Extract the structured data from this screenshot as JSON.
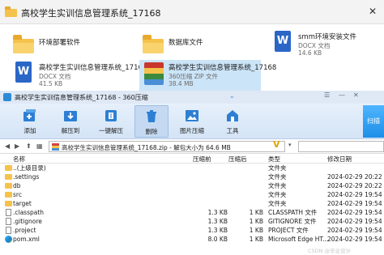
{
  "explorer": {
    "title": "高校学生实训信息管理系统_17168",
    "close_glyph": "✕",
    "files": [
      {
        "name": "环境部署软件",
        "kind": "folder"
      },
      {
        "name": "数据库文件",
        "kind": "folder"
      },
      {
        "name": "smm环境安装文件",
        "type": "DOCX 文档",
        "size": "14.6 KB",
        "kind": "word"
      },
      {
        "name": "高校学生实训信息管理系统_17168",
        "type": "DOCX 文档",
        "size": "41.5 KB",
        "kind": "word"
      },
      {
        "name": "高校学生实训信息管理系统_17168",
        "type": "360压缩 ZIP 文件",
        "size": "38.4 MB",
        "kind": "zip",
        "selected": true
      }
    ]
  },
  "zip": {
    "title": "高校学生实训信息管理系统_17168 - 360压缩",
    "menu_arrow": "⌄",
    "titlebar_buttons": [
      "☰",
      "—",
      "✕"
    ],
    "badge": "",
    "toolbar": [
      {
        "label": "添加",
        "icon": "add-icon"
      },
      {
        "label": "解压到",
        "icon": "extract-to-icon"
      },
      {
        "label": "一键解压",
        "icon": "one-click-extract-icon"
      },
      {
        "label": "删除",
        "icon": "delete-icon"
      },
      {
        "label": "图片压缩",
        "icon": "image-compress-icon"
      },
      {
        "label": "工具",
        "icon": "tools-icon"
      }
    ],
    "scan_label": "扫描",
    "nav": {
      "back": "◀",
      "forward": "▶",
      "up": "⬆",
      "view": "▦"
    },
    "address": "高校学生实训信息管理系统_17168.zip - 解包大小为 64.6 MB",
    "address_v": "V",
    "address_dropdown": "▾",
    "columns": {
      "name": "名称",
      "size": "压缩前",
      "csize": "压缩后",
      "type": "类型",
      "date": "修改日期"
    },
    "rows": [
      {
        "name": "..(上级目录)",
        "size": "",
        "csize": "",
        "type": "文件夹",
        "date": "",
        "icon": "up"
      },
      {
        "name": ".settings",
        "size": "",
        "csize": "",
        "type": "文件夹",
        "date": "2024-02-29 20:22",
        "icon": "folder"
      },
      {
        "name": "db",
        "size": "",
        "csize": "",
        "type": "文件夹",
        "date": "2024-02-29 20:22",
        "icon": "folder"
      },
      {
        "name": "src",
        "size": "",
        "csize": "",
        "type": "文件夹",
        "date": "2024-02-29 19:54",
        "icon": "folder"
      },
      {
        "name": "target",
        "size": "",
        "csize": "",
        "type": "文件夹",
        "date": "2024-02-29 19:54",
        "icon": "folder"
      },
      {
        "name": ".classpath",
        "size": "1.3 KB",
        "csize": "1 KB",
        "type": "CLASSPATH 文件",
        "date": "2024-02-29 19:54",
        "icon": "file"
      },
      {
        "name": ".gitignore",
        "size": "1.3 KB",
        "csize": "1 KB",
        "type": "GITIGNORE 文件",
        "date": "2024-02-29 19:54",
        "icon": "file"
      },
      {
        "name": ".project",
        "size": "1.3 KB",
        "csize": "1 KB",
        "type": "PROJECT 文件",
        "date": "2024-02-29 19:54",
        "icon": "file"
      },
      {
        "name": "pom.xml",
        "size": "8.0 KB",
        "csize": "1 KB",
        "type": "Microsoft Edge HT...",
        "date": "2024-02-29 19:54",
        "icon": "edge"
      }
    ]
  },
  "watermark": "CSDN @毕业设计"
}
